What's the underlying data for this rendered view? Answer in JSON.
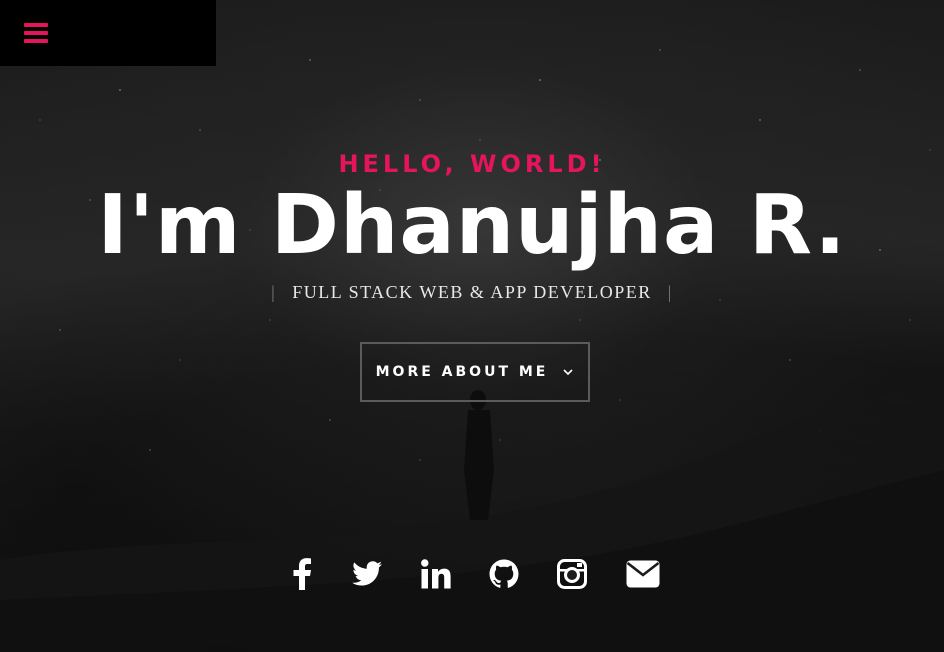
{
  "hero": {
    "greeting": "HELLO, WORLD!",
    "name": "I'm Dhanujha R.",
    "subtitle_sep": "|",
    "subtitle": "FULL STACK WEB & APP DEVELOPER",
    "cta_label": "MORE ABOUT ME"
  },
  "nav": {
    "menu_icon": "hamburger-menu-icon"
  },
  "social": [
    {
      "name": "facebook",
      "icon": "facebook-icon"
    },
    {
      "name": "twitter",
      "icon": "twitter-icon"
    },
    {
      "name": "linkedin",
      "icon": "linkedin-icon"
    },
    {
      "name": "github",
      "icon": "github-icon"
    },
    {
      "name": "instagram",
      "icon": "instagram-icon"
    },
    {
      "name": "email",
      "icon": "envelope-icon"
    }
  ],
  "colors": {
    "accent": "#e6135d",
    "text": "#ffffff",
    "background": "#1c1c1c"
  }
}
